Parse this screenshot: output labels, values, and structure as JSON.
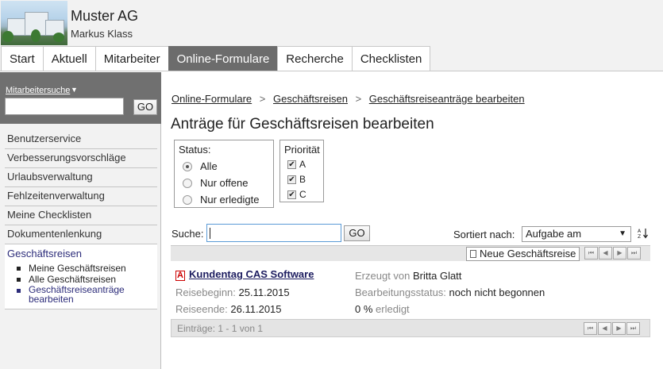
{
  "header": {
    "company": "Muster AG",
    "user": "Markus Klass"
  },
  "tabs": [
    {
      "label": "Start",
      "active": false
    },
    {
      "label": "Aktuell",
      "active": false
    },
    {
      "label": "Mitarbeiter",
      "active": false
    },
    {
      "label": "Online-Formulare",
      "active": true
    },
    {
      "label": "Recherche",
      "active": false
    },
    {
      "label": "Checklisten",
      "active": false
    }
  ],
  "sidebar": {
    "search_label": "Mitarbeitersuche",
    "go_label": "GO",
    "items": [
      "Benutzerservice",
      "Verbesserungsvorschläge",
      "Urlaubsverwaltung",
      "Fehlzeitenverwaltung",
      "Meine Checklisten",
      "Dokumentenlenkung"
    ],
    "active_section": {
      "title": "Geschäftsreisen",
      "subitems": [
        "Meine Geschäftsreisen",
        "Alle Geschäftsreisen",
        "Geschäftsreiseanträge bearbeiten"
      ]
    }
  },
  "breadcrumb": {
    "items": [
      "Online-Formulare",
      "Geschäftsreisen",
      "Geschäftsreiseanträge bearbeiten"
    ],
    "separator": ">"
  },
  "page_title": "Anträge für Geschäftsreisen bearbeiten",
  "status_filter": {
    "title": "Status:",
    "options": [
      {
        "label": "Alle",
        "selected": true
      },
      {
        "label": "Nur offene",
        "selected": false
      },
      {
        "label": "Nur erledigte",
        "selected": false
      }
    ]
  },
  "priority_filter": {
    "title": "Priorität",
    "options": [
      {
        "label": "A",
        "checked": true
      },
      {
        "label": "B",
        "checked": true
      },
      {
        "label": "C",
        "checked": true
      }
    ]
  },
  "search": {
    "label": "Suche:",
    "value": "",
    "go_label": "GO"
  },
  "sort": {
    "label": "Sortiert nach:",
    "value": "Aufgabe am"
  },
  "toolbar": {
    "new_label": "Neue Geschäftsreise"
  },
  "entry": {
    "badge": "A",
    "title": "Kundentag CAS Software",
    "start_label": "Reisebeginn:",
    "start_value": "25.11.2015",
    "end_label": "Reiseende:",
    "end_value": "26.11.2015",
    "creator_label": "Erzeugt von",
    "creator_value": "Britta Glatt",
    "status_label": "Bearbeitungsstatus:",
    "status_value": "noch nicht begonnen",
    "progress_value": "0 %",
    "progress_label": "erledigt"
  },
  "footer": {
    "entries_text": "Einträge: 1 - 1 von 1"
  },
  "colors": {
    "active_tab": "#6c6c6c",
    "sidebar_header": "#707070",
    "link_dark": "#1d1d60"
  }
}
